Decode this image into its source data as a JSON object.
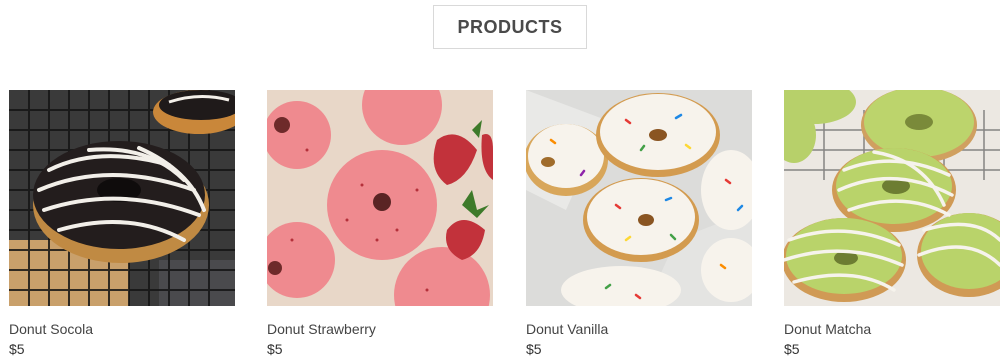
{
  "header": {
    "title": "PRODUCTS"
  },
  "products": [
    {
      "name": "Donut Socola",
      "price": "$5",
      "image": "chocolate-donut-image"
    },
    {
      "name": "Donut Strawberry",
      "price": "$5",
      "image": "strawberry-donut-image"
    },
    {
      "name": "Donut Vanilla",
      "price": "$5",
      "image": "vanilla-sprinkle-donut-image"
    },
    {
      "name": "Donut Matcha",
      "price": "$5",
      "image": "matcha-donut-image"
    }
  ],
  "colors": {
    "chocolate": "#2b2424",
    "strawberry": "#f08a92",
    "vanilla_icing": "#f5f1ea",
    "matcha": "#b9d36a"
  }
}
